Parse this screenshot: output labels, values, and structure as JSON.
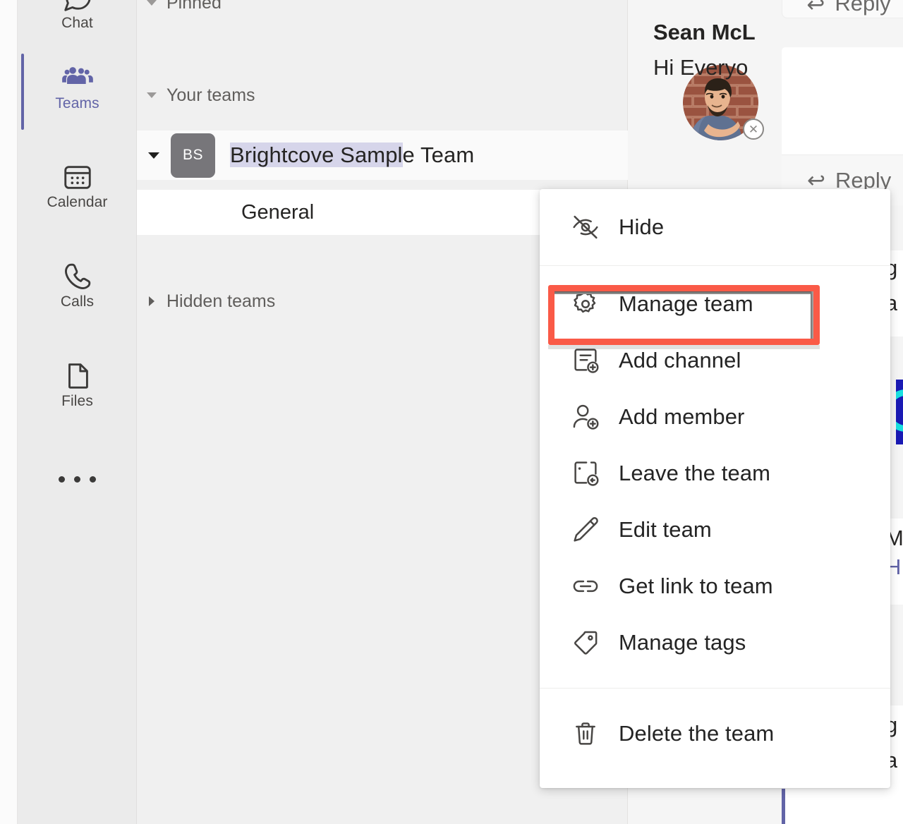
{
  "app_rail": {
    "items": [
      {
        "label": "Chat",
        "icon": "chat-icon",
        "active": false
      },
      {
        "label": "Teams",
        "icon": "teams-icon",
        "active": true
      },
      {
        "label": "Calendar",
        "icon": "calendar-icon",
        "active": false
      },
      {
        "label": "Calls",
        "icon": "calls-icon",
        "active": false
      },
      {
        "label": "Files",
        "icon": "files-icon",
        "active": false
      }
    ],
    "overflow_label": "...",
    "active_color": "#6264a7"
  },
  "teams_panel": {
    "groups": [
      {
        "label": "Pinned",
        "expanded": true
      },
      {
        "label": "Your teams",
        "expanded": true
      },
      {
        "label": "Hidden teams",
        "expanded": false
      }
    ],
    "team": {
      "initials": "BS",
      "name_selected": "Brightcove Sampl",
      "name_rest": "e Team",
      "full_name": "Brightcove Sample Team",
      "expanded": true,
      "selection_color": "#d6d5ea",
      "avatar_color": "#77767a",
      "more_label": "..."
    },
    "channels": [
      {
        "label": "General",
        "selected": true
      }
    ]
  },
  "context_menu": {
    "items": [
      {
        "label": "Hide",
        "icon": "eye-off-icon",
        "highlighted": false
      },
      {
        "label": "Manage team",
        "icon": "gear-icon",
        "highlighted": true
      },
      {
        "label": "Add channel",
        "icon": "add-channel-icon",
        "highlighted": false
      },
      {
        "label": "Add member",
        "icon": "add-member-icon",
        "highlighted": false
      },
      {
        "label": "Leave the team",
        "icon": "leave-team-icon",
        "highlighted": false
      },
      {
        "label": "Edit team",
        "icon": "pencil-icon",
        "highlighted": false
      },
      {
        "label": "Get link to team",
        "icon": "link-icon",
        "highlighted": false
      },
      {
        "label": "Manage tags",
        "icon": "tag-icon",
        "highlighted": false
      },
      {
        "label": "Delete the team",
        "icon": "trash-icon",
        "highlighted": false
      }
    ],
    "annotation_color": "#fa5a47"
  },
  "content": {
    "reply_top_label": "Reply",
    "message": {
      "author": "Sean McL",
      "text": "Hi Everyo",
      "reply_label": "Reply",
      "presence": "offline"
    },
    "edge_fragments": {
      "frag_1": "g",
      "frag_2": "a",
      "frag_3": "M",
      "frag_4": "H",
      "frag_5": "g",
      "frag_6": "a"
    }
  }
}
